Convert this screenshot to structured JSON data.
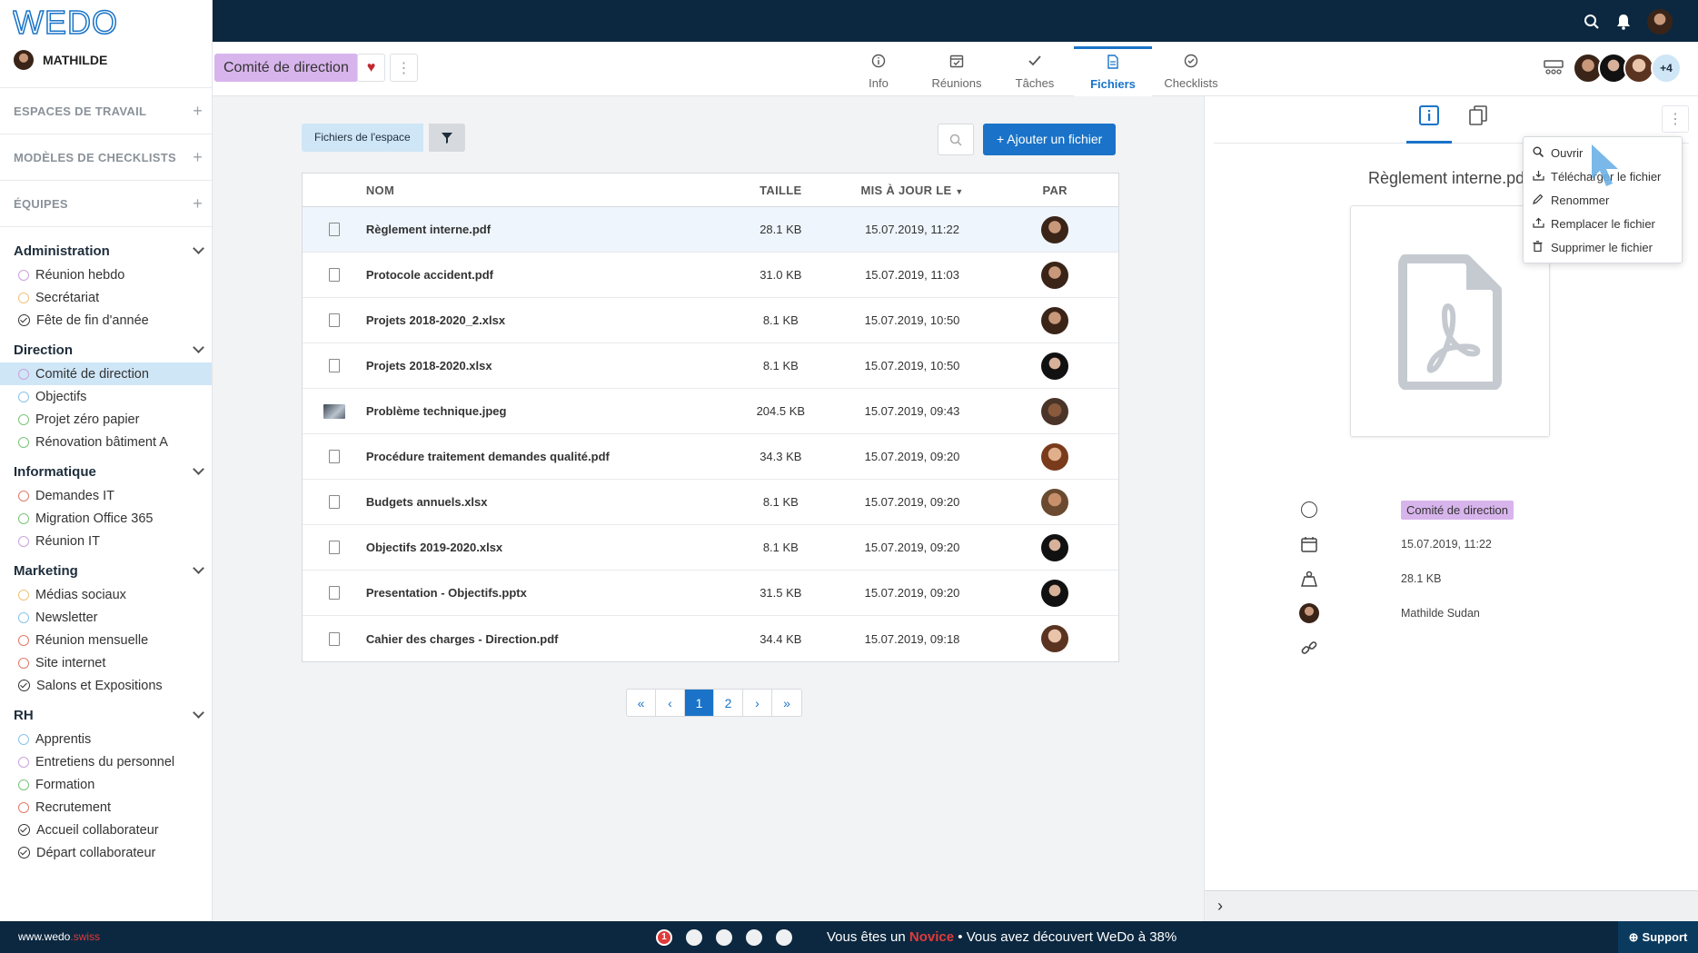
{
  "app": {
    "brand": "WEDO",
    "user": "MATHILDE"
  },
  "sidebar": {
    "sections": [
      {
        "label": "ESPACES DE TRAVAIL"
      },
      {
        "label": "MODÈLES DE CHECKLISTS"
      },
      {
        "label": "ÉQUIPES"
      }
    ],
    "groups": [
      {
        "name": "Administration",
        "items": [
          {
            "label": "Réunion hebdo",
            "type": "dot",
            "color": "#c9a3dc"
          },
          {
            "label": "Secrétariat",
            "type": "dot",
            "color": "#f0c27a"
          },
          {
            "label": "Fête de fin d'année",
            "type": "check"
          }
        ]
      },
      {
        "name": "Direction",
        "items": [
          {
            "label": "Comité de direction",
            "type": "dot",
            "color": "#c9a3dc",
            "active": true
          },
          {
            "label": "Objectifs",
            "type": "dot",
            "color": "#8ac4e6"
          },
          {
            "label": "Projet zéro papier",
            "type": "dot",
            "color": "#7cc47a"
          },
          {
            "label": "Rénovation bâtiment A",
            "type": "dot",
            "color": "#7cc47a"
          }
        ]
      },
      {
        "name": "Informatique",
        "items": [
          {
            "label": "Demandes IT",
            "type": "dot",
            "color": "#e07a6a"
          },
          {
            "label": "Migration Office 365",
            "type": "dot",
            "color": "#7cc47a"
          },
          {
            "label": "Réunion IT",
            "type": "dot",
            "color": "#c9a3dc"
          }
        ]
      },
      {
        "name": "Marketing",
        "items": [
          {
            "label": "Médias sociaux",
            "type": "dot",
            "color": "#f0c27a"
          },
          {
            "label": "Newsletter",
            "type": "dot",
            "color": "#8ac4e6"
          },
          {
            "label": "Réunion mensuelle",
            "type": "dot",
            "color": "#e07a6a"
          },
          {
            "label": "Site internet",
            "type": "dot",
            "color": "#e07a6a"
          },
          {
            "label": "Salons et Expositions",
            "type": "check"
          }
        ]
      },
      {
        "name": "RH",
        "items": [
          {
            "label": "Apprentis",
            "type": "dot",
            "color": "#8ac4e6"
          },
          {
            "label": "Entretiens du personnel",
            "type": "dot",
            "color": "#c9a3dc"
          },
          {
            "label": "Formation",
            "type": "dot",
            "color": "#7cc47a"
          },
          {
            "label": "Recrutement",
            "type": "dot",
            "color": "#e07a6a"
          },
          {
            "label": "Accueil collaborateur",
            "type": "check"
          },
          {
            "label": "Départ collaborateur",
            "type": "check"
          }
        ]
      }
    ]
  },
  "workspace": {
    "name": "Comité de direction",
    "more_members": "+4"
  },
  "tabs": [
    {
      "label": "Info",
      "icon": "info-icon"
    },
    {
      "label": "Réunions",
      "icon": "calendar-check-icon"
    },
    {
      "label": "Tâches",
      "icon": "check-icon"
    },
    {
      "label": "Fichiers",
      "icon": "file-icon",
      "active": true
    },
    {
      "label": "Checklists",
      "icon": "checklist-icon"
    }
  ],
  "files": {
    "filter_label": "Fichiers de l'espace",
    "add_label": "+ Ajouter un fichier",
    "columns": {
      "name": "NOM",
      "size": "TAILLE",
      "date": "MIS À JOUR LE",
      "by": "PAR"
    },
    "rows": [
      {
        "name": "Règlement interne.pdf",
        "size": "28.1 KB",
        "date": "15.07.2019, 11:22",
        "kind": "pdf",
        "selected": true
      },
      {
        "name": "Protocole accident.pdf",
        "size": "31.0 KB",
        "date": "15.07.2019, 11:03",
        "kind": "pdf"
      },
      {
        "name": "Projets 2018-2020_2.xlsx",
        "size": "8.1 KB",
        "date": "15.07.2019, 10:50",
        "kind": "xls"
      },
      {
        "name": "Projets 2018-2020.xlsx",
        "size": "8.1 KB",
        "date": "15.07.2019, 10:50",
        "kind": "xls"
      },
      {
        "name": "Problème technique.jpeg",
        "size": "204.5 KB",
        "date": "15.07.2019, 09:43",
        "kind": "img"
      },
      {
        "name": "Procédure traitement demandes qualité.pdf",
        "size": "34.3 KB",
        "date": "15.07.2019, 09:20",
        "kind": "pdf"
      },
      {
        "name": "Budgets annuels.xlsx",
        "size": "8.1 KB",
        "date": "15.07.2019, 09:20",
        "kind": "xls"
      },
      {
        "name": "Objectifs 2019-2020.xlsx",
        "size": "8.1 KB",
        "date": "15.07.2019, 09:20",
        "kind": "xls"
      },
      {
        "name": "Presentation - Objectifs.pptx",
        "size": "31.5 KB",
        "date": "15.07.2019, 09:20",
        "kind": "ppt"
      },
      {
        "name": "Cahier des charges - Direction.pdf",
        "size": "34.4 KB",
        "date": "15.07.2019, 09:18",
        "kind": "pdf"
      }
    ],
    "pagination": [
      "«",
      "‹",
      "1",
      "2",
      "›",
      "»"
    ],
    "current_page": "1"
  },
  "detail": {
    "title": "Règlement interne.pdf",
    "workspace": "Comité de direction",
    "date": "15.07.2019, 11:22",
    "size": "28.1 KB",
    "owner": "Mathilde Sudan"
  },
  "context_menu": [
    {
      "label": "Ouvrir",
      "icon": "zoom-icon"
    },
    {
      "label": "Télécharger le fichier",
      "icon": "download-icon"
    },
    {
      "label": "Renommer",
      "icon": "pencil-icon"
    },
    {
      "label": "Remplacer le fichier",
      "icon": "upload-icon"
    },
    {
      "label": "Supprimer le fichier",
      "icon": "trash-icon"
    }
  ],
  "footer": {
    "url_main": "www.wedo",
    "url_tld": ".swiss",
    "progress_first": "1",
    "msg_pre": "Vous êtes un ",
    "level": "Novice",
    "msg_post": " • Vous avez découvert WeDo à 38%",
    "support": "Support"
  }
}
